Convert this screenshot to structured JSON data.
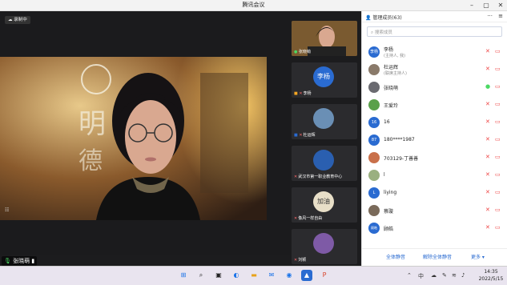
{
  "window": {
    "title": "腾讯会议",
    "recording_label": "录制中"
  },
  "main_video": {
    "speaker_name": "张晓萌"
  },
  "thumbnails": [
    {
      "name": "张晓萌",
      "type": "video"
    },
    {
      "name": "李杨",
      "type": "avatar",
      "avatar_text": "李杨",
      "color": "#2a6bd1"
    },
    {
      "name": "杜运辉",
      "type": "avatar",
      "avatar_text": "",
      "color": "#6a8fb5"
    },
    {
      "name": "武汉市第一职业教育中心",
      "type": "avatar",
      "avatar_text": "",
      "color": "#2a5fb0"
    },
    {
      "name": "像风一样自由",
      "type": "avatar",
      "avatar_text": "加油",
      "color": "#e8dfc8"
    },
    {
      "name": "刘颖",
      "type": "avatar",
      "avatar_text": "",
      "color": "#7e5aa6"
    }
  ],
  "panel": {
    "title": "管理成员(63)",
    "more_label": "···",
    "close_label": "≡",
    "search_placeholder": "搜索成员",
    "members": [
      {
        "name": "李杨",
        "role": "(主持人, 我)",
        "avatar": "李杨",
        "color": "#2a6bd1"
      },
      {
        "name": "杜运辉",
        "role": "(联席主持人)",
        "avatar": "",
        "color": "#8a7a6a"
      },
      {
        "name": "张晓萌",
        "role": "",
        "avatar": "",
        "color": "#6a6a70"
      },
      {
        "name": "王爱玲",
        "role": "",
        "avatar": "",
        "color": "#5aa04a"
      },
      {
        "name": "16",
        "role": "",
        "avatar": "16",
        "color": "#2a6bd1"
      },
      {
        "name": "180****1987",
        "role": "",
        "avatar": "87",
        "color": "#2a6bd1"
      },
      {
        "name": "703129-丁善善",
        "role": "",
        "avatar": "",
        "color": "#c9704a"
      },
      {
        "name": "l",
        "role": "",
        "avatar": "",
        "color": "#9ab080"
      },
      {
        "name": "liying",
        "role": "",
        "avatar": "L",
        "color": "#2a6bd1"
      },
      {
        "name": "蔡璇",
        "role": "",
        "avatar": "",
        "color": "#7a6a5a"
      },
      {
        "name": "顾皓",
        "role": "",
        "avatar": "顾皓",
        "color": "#2a6bd1"
      }
    ],
    "footer": {
      "mute_all": "全体静音",
      "unmute_all": "解除全体静音",
      "more": "更多 ▾"
    }
  },
  "taskbar": {
    "tray_lang": "中",
    "time": "14:35",
    "date": "2022/5/15"
  }
}
